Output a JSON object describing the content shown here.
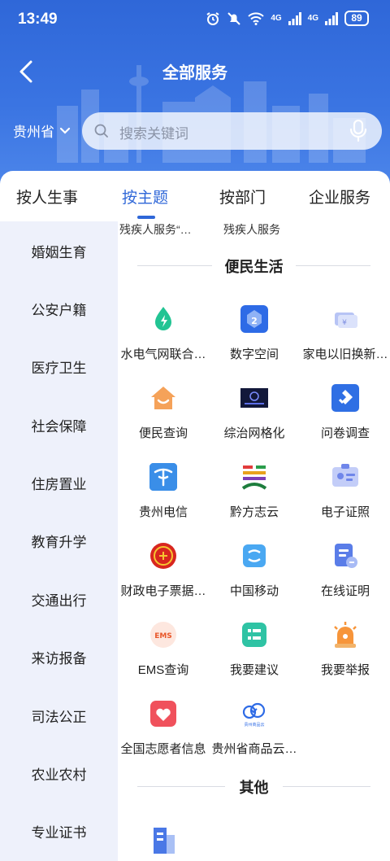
{
  "status_bar": {
    "time": "13:49",
    "network_1": "4G",
    "network_2": "4G",
    "battery": "89"
  },
  "header": {
    "title": "全部服务",
    "region": "贵州省",
    "search_placeholder": "搜索关键词"
  },
  "tabs": [
    {
      "label": "按人生事",
      "active": false
    },
    {
      "label": "按主题",
      "active": true
    },
    {
      "label": "按部门",
      "active": false
    },
    {
      "label": "企业服务",
      "active": false
    }
  ],
  "sidebar": [
    "婚姻生育",
    "公安户籍",
    "医疗卫生",
    "社会保障",
    "住房置业",
    "教育升学",
    "交通出行",
    "来访报备",
    "司法公正",
    "农业农村",
    "专业证书"
  ],
  "top_items": [
    "残疾人服务“…",
    "残疾人服务"
  ],
  "sections": [
    {
      "title": "便民生活",
      "services": [
        {
          "label": "水电气网联合…",
          "icon": "water-drop-icon"
        },
        {
          "label": "数字空间",
          "icon": "digital-space-icon"
        },
        {
          "label": "家电以旧换新…",
          "icon": "ticket-icon"
        },
        {
          "label": "便民查询",
          "icon": "house-smile-icon"
        },
        {
          "label": "综治网格化",
          "icon": "grid-management-icon"
        },
        {
          "label": "问卷调查",
          "icon": "questionnaire-icon"
        },
        {
          "label": "贵州电信",
          "icon": "china-telecom-icon"
        },
        {
          "label": "黔方志云",
          "icon": "qianfangzhi-icon"
        },
        {
          "label": "电子证照",
          "icon": "id-card-icon"
        },
        {
          "label": "财政电子票据…",
          "icon": "emblem-icon"
        },
        {
          "label": "中国移动",
          "icon": "china-mobile-icon"
        },
        {
          "label": "在线证明",
          "icon": "document-icon"
        },
        {
          "label": "EMS查询",
          "icon": "ems-icon"
        },
        {
          "label": "我要建议",
          "icon": "suggestion-icon"
        },
        {
          "label": "我要举报",
          "icon": "alarm-icon"
        },
        {
          "label": "全国志愿者信息",
          "icon": "heart-icon"
        },
        {
          "label": "贵州省商品云…",
          "icon": "cloud-icon",
          "caption": "贵州商品云"
        }
      ]
    },
    {
      "title": "其他",
      "services": [
        {
          "label": "",
          "icon": "building-icon"
        }
      ]
    }
  ],
  "colors": {
    "accent": "#2f67d8",
    "sidebar_bg": "#eef1fb"
  }
}
